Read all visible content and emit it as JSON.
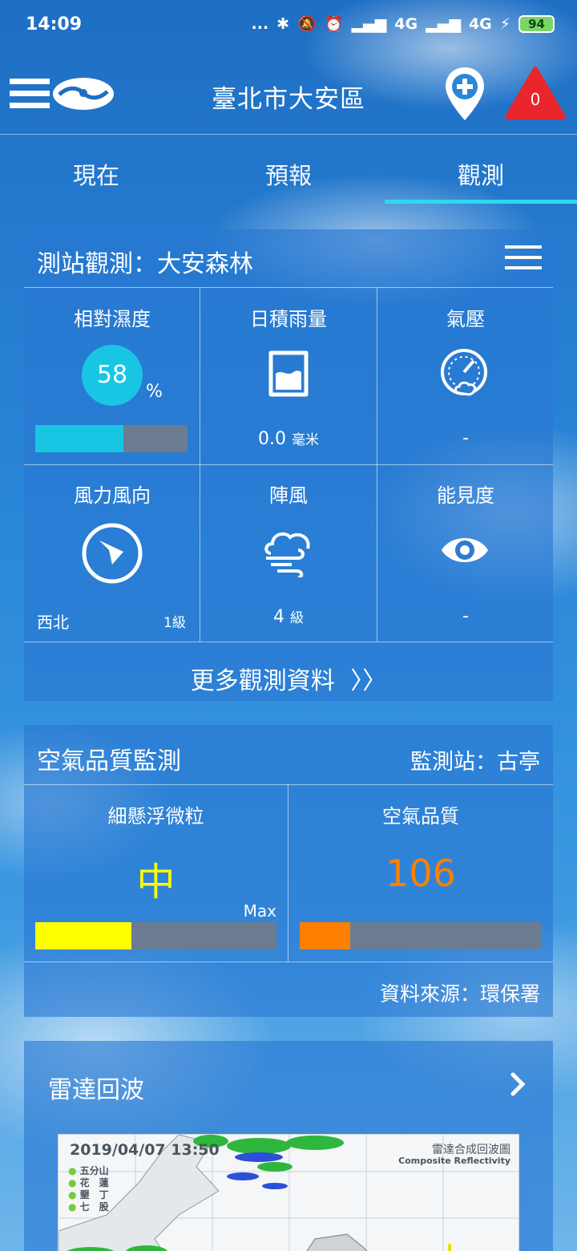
{
  "status_bar": {
    "time": "14:09",
    "dots": "...",
    "net1": "4G",
    "net2": "4G",
    "battery": "94"
  },
  "header": {
    "location": "臺北市大安區",
    "alert_count": "0"
  },
  "tabs": [
    {
      "label": "現在",
      "active": false
    },
    {
      "label": "預報",
      "active": false
    },
    {
      "label": "觀測",
      "active": true
    }
  ],
  "observation": {
    "title": "測站觀測：大安森林",
    "humidity": {
      "label": "相對濕度",
      "value": "58",
      "unit": "%",
      "level": 0.58
    },
    "rain": {
      "label": "日積雨量",
      "value": "0.0",
      "unit": "毫米"
    },
    "pressure": {
      "label": "氣壓",
      "value": "-"
    },
    "wind": {
      "label": "風力風向",
      "direction": "西北",
      "level": "1級"
    },
    "gust": {
      "label": "陣風",
      "value": "4",
      "unit": "級"
    },
    "visibility": {
      "label": "能見度",
      "value": "-"
    },
    "more_label": "更多觀測資料"
  },
  "air_quality": {
    "title": "空氣品質監測",
    "station": "監測站：古亭",
    "pm": {
      "label": "細懸浮微粒",
      "value": "中",
      "max_label": "Max",
      "level": 0.4,
      "color": "#ffff00"
    },
    "aqi": {
      "label": "空氣品質",
      "value": "106",
      "level": 0.21,
      "color": "#ff7f00"
    },
    "source": "資料來源：環保署"
  },
  "radar": {
    "title": "雷達回波",
    "timestamp": "2019/04/07  13:50",
    "map_title": "雷達合成回波圖",
    "map_subtitle": "Composite Reflectivity",
    "stations": [
      "五分山",
      "花　蓮",
      "墾　丁",
      "七　股"
    ]
  },
  "colors": {
    "accent": "#2fd7ee",
    "humidity": "#18c6e4",
    "alert": "#e8262b"
  }
}
